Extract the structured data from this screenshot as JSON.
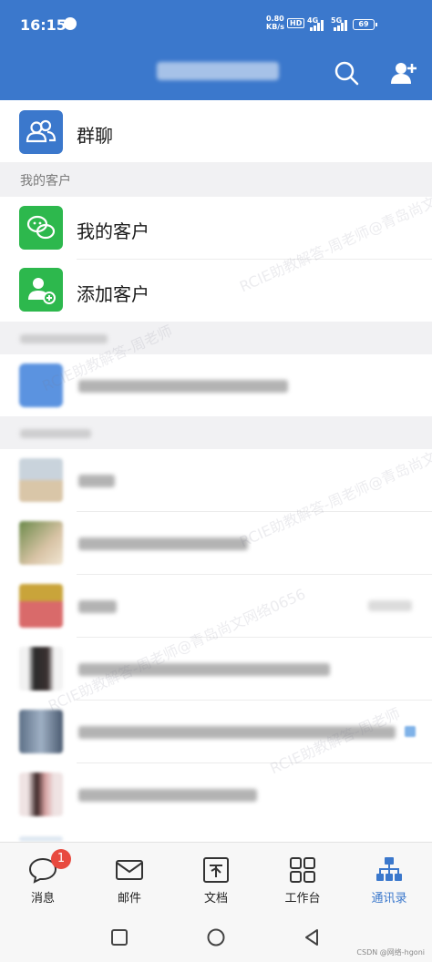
{
  "status_bar": {
    "time": "16:15",
    "net_speed_value": "0.80",
    "net_speed_unit": "KB/s",
    "hd_label": "HD",
    "signal_4g": "4G",
    "signal_5g": "5G",
    "battery": "69"
  },
  "header": {
    "title_blurred": true,
    "search_icon": "search-icon",
    "add_contact_icon": "add-contact-icon"
  },
  "contacts": {
    "group_chat_label": "群聊",
    "section_my_customers": "我的客户",
    "my_customers_label": "我的客户",
    "add_customer_label": "添加客户"
  },
  "bottom_nav": {
    "tabs": [
      {
        "label": "消息",
        "icon": "message-icon",
        "badge": "1"
      },
      {
        "label": "邮件",
        "icon": "mail-icon"
      },
      {
        "label": "文档",
        "icon": "document-icon"
      },
      {
        "label": "工作台",
        "icon": "workbench-icon"
      },
      {
        "label": "通讯录",
        "icon": "contacts-icon",
        "active": true
      }
    ]
  },
  "footer": {
    "credit": "CSDN @网络-hgoni"
  },
  "colors": {
    "primary": "#3b78cc",
    "green": "#2db84d",
    "badge_red": "#e84a3f",
    "section_bg": "#f1f1f3"
  }
}
